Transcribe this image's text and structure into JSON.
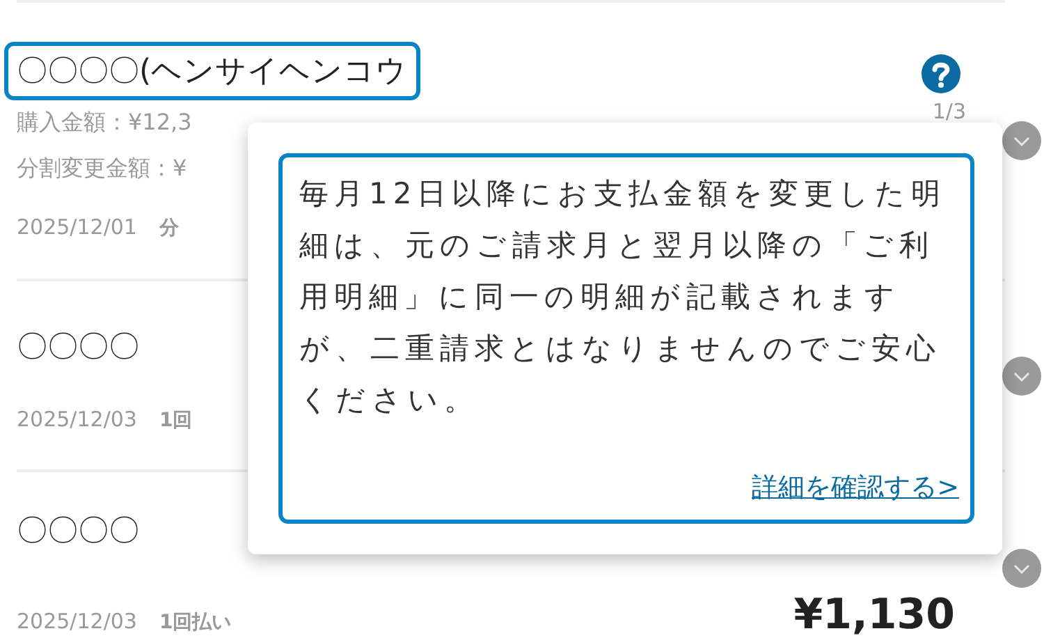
{
  "items": [
    {
      "title": "〇〇〇〇(ヘンサイヘンコウ",
      "highlighted": true,
      "help": true,
      "purchase": "購入金額：¥12,3",
      "change": "分割変更金額：¥",
      "date": "2025/12/01",
      "plan": "分",
      "installment": "1/3"
    },
    {
      "title": "〇〇〇〇",
      "highlighted": false,
      "help": false,
      "date": "2025/12/03",
      "plan": "1回"
    },
    {
      "title": "〇〇〇〇",
      "highlighted": false,
      "help": false,
      "date": "2025/12/03",
      "plan": "1回払い",
      "amount": "¥1,130"
    }
  ],
  "popup": {
    "text": "毎月12日以降にお支払金額を変更した明細は、元のご請求月と翌月以降の「ご利用明細」に同一の明細が記載されますが、二重請求とはなりませんのでご安心ください。",
    "link": "詳細を確認する>"
  }
}
